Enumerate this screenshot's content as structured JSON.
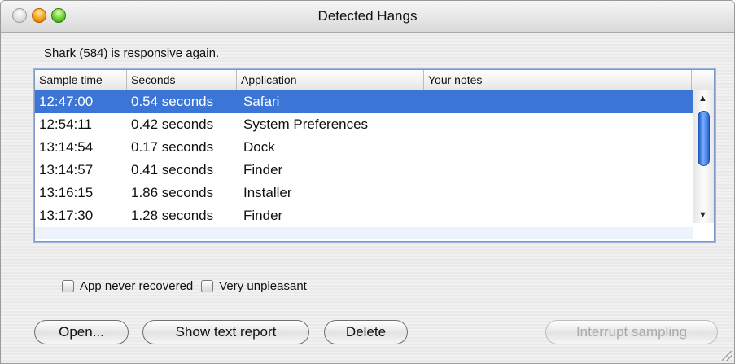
{
  "window": {
    "title": "Detected Hangs",
    "buttons": [
      "close-button",
      "minimize-button",
      "zoom-button"
    ]
  },
  "status": "Shark (584) is responsive again.",
  "table": {
    "columns": [
      "Sample time",
      "Seconds",
      "Application",
      "Your notes"
    ],
    "rows": [
      {
        "time": "12:47:00",
        "seconds": "0.54 seconds",
        "app": "Safari",
        "notes": "",
        "selected": true
      },
      {
        "time": "12:54:11",
        "seconds": "0.42 seconds",
        "app": "System Preferences",
        "notes": ""
      },
      {
        "time": "13:14:54",
        "seconds": "0.17 seconds",
        "app": "Dock",
        "notes": ""
      },
      {
        "time": "13:14:57",
        "seconds": "0.41 seconds",
        "app": "Finder",
        "notes": ""
      },
      {
        "time": "13:16:15",
        "seconds": "1.86 seconds",
        "app": "Installer",
        "notes": ""
      },
      {
        "time": "13:17:30",
        "seconds": "1.28 seconds",
        "app": "Finder",
        "notes": ""
      }
    ],
    "selection_color": "#3b75d6"
  },
  "checkboxes": {
    "never_recovered": "App never recovered",
    "very_unpleasant": "Very unpleasant"
  },
  "buttons": {
    "open": "Open...",
    "show_report": "Show text report",
    "delete": "Delete",
    "interrupt": "Interrupt sampling"
  }
}
